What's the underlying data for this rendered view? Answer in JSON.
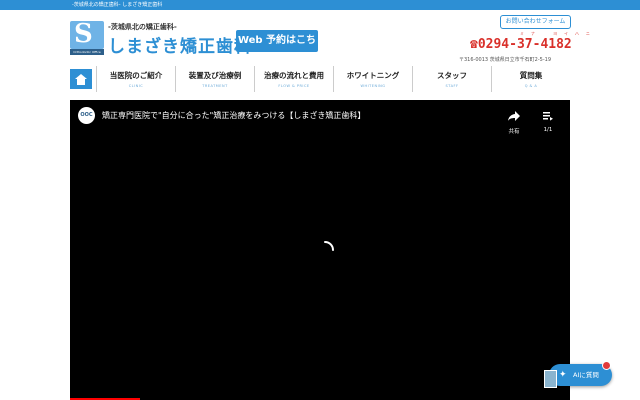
{
  "topbar": {
    "text": "-茨城県北の矯正歯科- しまざき矯正歯科"
  },
  "header": {
    "tagline": "-茨城県北の矯正歯科-",
    "clinic_name": "しまざき矯正歯科",
    "logo_letter": "S",
    "logo_sub": "Orthodontic Office",
    "web_booking": "Web 予約はこちら",
    "contact_button": "お問い合わせフォーム",
    "phone": "☎0294-37-4182",
    "phone_kana": "ミナ　ヨイハニ",
    "address": "〒316-0013 茨城県日立市千石町2-5-19"
  },
  "nav": {
    "items": [
      {
        "jp": "当医院のご紹介",
        "en": "CLINIC"
      },
      {
        "jp": "装置及び治療例",
        "en": "TREATMENT"
      },
      {
        "jp": "治療の流れと費用",
        "en": "FLOW & PRICE"
      },
      {
        "jp": "ホワイトニング",
        "en": "WHITENING"
      },
      {
        "jp": "スタッフ",
        "en": "STAFF"
      },
      {
        "jp": "質問集",
        "en": "Q & A"
      }
    ]
  },
  "video": {
    "channel_badge": "OOC",
    "title": "矯正専門医院で\"自分に合った\"矯正治療をみつける【しまざき矯正歯科】",
    "share_label": "共有",
    "playlist_label": "1/1",
    "progress": 0.14
  },
  "ai_button": {
    "label": "AIに質問"
  },
  "colors": {
    "brand": "#2d8fd4",
    "phone": "#d9302a"
  }
}
